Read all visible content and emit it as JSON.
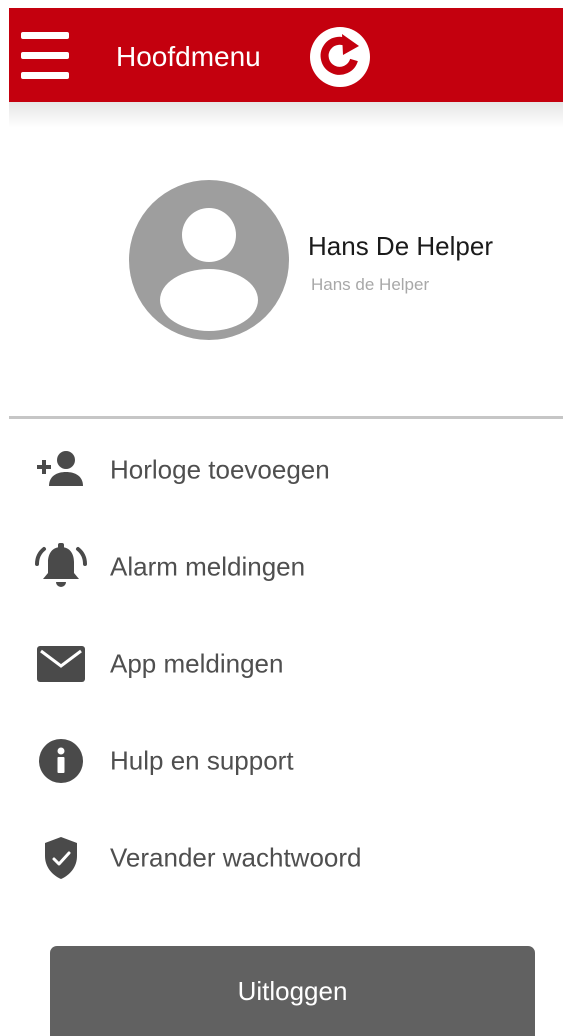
{
  "header": {
    "title": "Hoofdmenu",
    "menu_icon": "hamburger-menu-icon",
    "refresh_icon": "refresh-icon",
    "background_color": "#c4000e"
  },
  "profile": {
    "name": "Hans De Helper",
    "subtitle": "Hans de Helper",
    "avatar_icon": "avatar-placeholder-icon"
  },
  "menu": {
    "items": [
      {
        "label": "Horloge toevoegen",
        "icon": "add-person-icon"
      },
      {
        "label": "Alarm meldingen",
        "icon": "alarm-bell-icon"
      },
      {
        "label": "App meldingen",
        "icon": "envelope-icon"
      },
      {
        "label": "Hulp en support",
        "icon": "info-icon"
      },
      {
        "label": "Verander wachtwoord",
        "icon": "shield-check-icon"
      }
    ]
  },
  "logout": {
    "label": "Uitloggen",
    "color": "#616161"
  }
}
